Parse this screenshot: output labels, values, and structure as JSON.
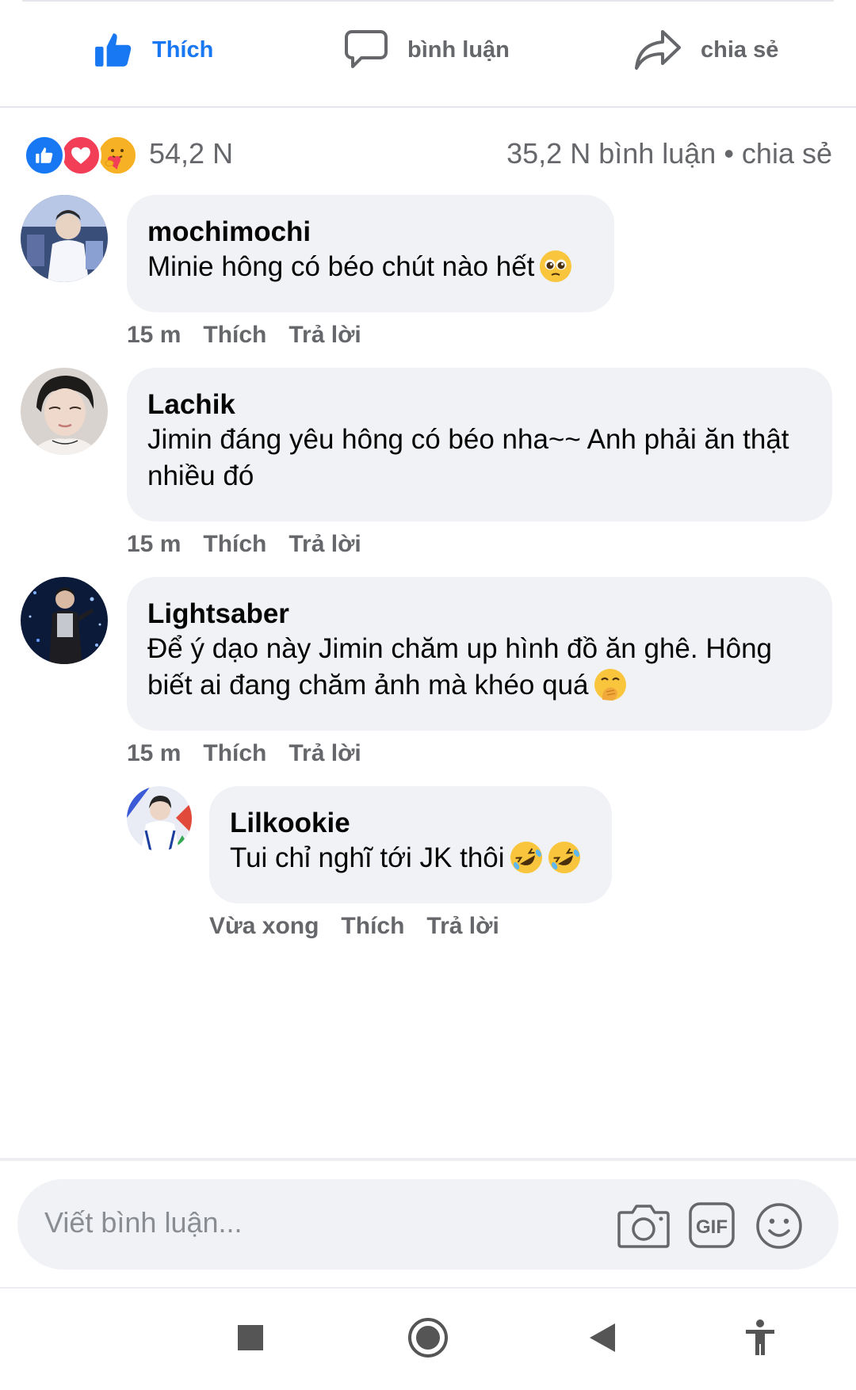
{
  "actions": {
    "like_label": "Thích",
    "comment_label": "bình luận",
    "share_label": "chia sẻ"
  },
  "reactions": {
    "count": "54,2 N",
    "summary": "35,2 N  bình luận • chia sẻ",
    "types": [
      "like-icon",
      "love-icon",
      "care-icon"
    ]
  },
  "comments": [
    {
      "author": "mochimochi",
      "text": "Minie hông có béo chút nào hết",
      "emoji": "pleading-face-emoji",
      "time": "15 m",
      "like": "Thích",
      "reply": "Trả lời"
    },
    {
      "author": "Lachik",
      "text": "Jimin đáng yêu hông có béo nha~~ Anh phải ăn thật nhiều đó",
      "time": "15 m",
      "like": "Thích",
      "reply": "Trả lời"
    },
    {
      "author": "Lightsaber",
      "text": "Để ý dạo này Jimin chăm up hình đồ ăn ghê. Hông biết ai đang chăm ảnh mà khéo quá",
      "emoji": "hand-over-mouth-emoji",
      "time": "15 m",
      "like": "Thích",
      "reply": "Trả lời"
    }
  ],
  "reply": {
    "author": "Lilkookie",
    "text": "Tui chỉ nghĩ tới JK thôi",
    "emoji": "rolling-laughing-emoji",
    "time": "Vừa xong",
    "like": "Thích",
    "reply": "Trả lời"
  },
  "input": {
    "placeholder": "Viết bình luận...",
    "icons": [
      "camera-icon",
      "gif-icon",
      "smiley-icon"
    ]
  },
  "navbar": {
    "icons": [
      "recents-icon",
      "home-icon",
      "back-icon",
      "accessibility-icon"
    ]
  },
  "colors": {
    "brand": "#1877f2",
    "secondary_text": "#65676b",
    "bubble": "#f0f2f5"
  }
}
